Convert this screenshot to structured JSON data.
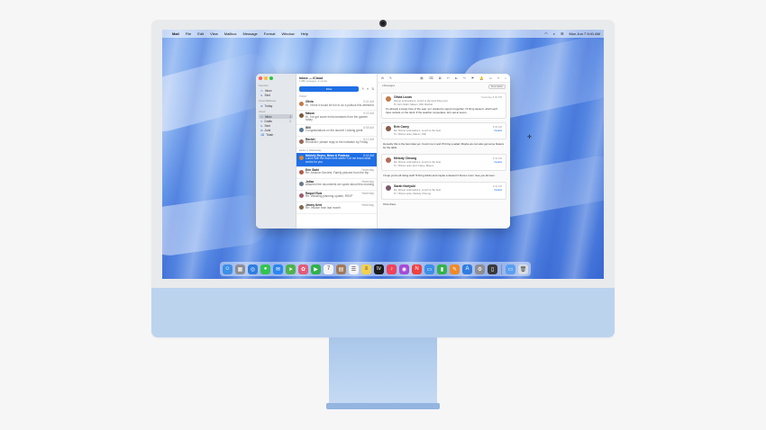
{
  "menubar": {
    "app_name": "Mail",
    "items": [
      "File",
      "Edit",
      "View",
      "Mailbox",
      "Message",
      "Format",
      "Window",
      "Help"
    ],
    "clock": "Mon Jun 7 9:41 AM"
  },
  "mail": {
    "sidebar": {
      "favorites_heading": "Favorites",
      "favorites": [
        {
          "label": "Inbox",
          "icon": "inbox-icon"
        },
        {
          "label": "Sent",
          "icon": "sent-icon"
        }
      ],
      "smart_heading": "Smart Mailboxes",
      "smart": [
        {
          "label": "Today",
          "icon": "gear-icon"
        }
      ],
      "icloud_heading": "iCloud",
      "mailboxes": [
        {
          "label": "Inbox",
          "count": "4",
          "active": true
        },
        {
          "label": "Drafts",
          "count": "2",
          "active": false
        },
        {
          "label": "Sent",
          "count": "",
          "active": false
        },
        {
          "label": "Junk",
          "count": "",
          "active": false
        },
        {
          "label": "Trash",
          "count": "",
          "active": false
        }
      ]
    },
    "list": {
      "title": "Inbox — iCloud",
      "subtitle": "1,988 messages, 4 unread",
      "filter_label": "Filter",
      "today_label": "TODAY",
      "yesterday_label": "Earlier in Wednesday",
      "messages": [
        {
          "from": "Olivia",
          "time": "9:41 AM",
          "preview": "Hi, I think it would be fun to do a potluck this weekend",
          "color": "#c47a4a",
          "selected": false
        },
        {
          "from": "Mason",
          "time": "9:20 AM",
          "preview": "Hi, I've got some extra tomatoes from the garden today",
          "color": "#7a5a3a",
          "selected": false
        },
        {
          "from": "Will",
          "time": "8:55 AM",
          "preview": "Congratulations on the launch! Looking great",
          "color": "#5a7a9a",
          "selected": false
        },
        {
          "from": "Rachel",
          "time": "8:12 AM",
          "preview": "Reminder: please reply to the invitation by Friday",
          "color": "#9a6a5a",
          "selected": false
        },
        {
          "from": "Mckinly Reyes, Brian & Pradeep",
          "time": "8:02 AM",
          "preview": "Lunch with the team next week? Let me know what works for you",
          "color": "#d48a3a",
          "selected": true
        },
        {
          "from": "Erin Stahl",
          "time": "Yesterday",
          "preview": "Re: Amazon Secrets: Family pictures from the trip",
          "color": "#b55a4a",
          "selected": false
        },
        {
          "from": "Jolisa",
          "time": "Yesterday",
          "preview": "Attached the documents we spoke about this morning",
          "color": "#6a7a8a",
          "selected": false
        },
        {
          "from": "Raquel Ruiz",
          "time": "Yesterday",
          "preview": "Re: Wedding planning update, RSVP",
          "color": "#a05a6a",
          "selected": false
        },
        {
          "from": "Jimmy Kent",
          "time": "Yesterday",
          "preview": "Re: Invoice from last month",
          "color": "#7a6a4a",
          "selected": false
        }
      ]
    },
    "reader": {
      "thread_count": "4 Messages",
      "thread_badge": "Summarize",
      "cards": [
        {
          "name": "Olivia Lucas",
          "subject": "Dinner at Emeline's: Lunch is the best thing ever",
          "recipients": "To: Erin Stahl, Mason, Will, Rachel",
          "time": "Yesterday 8:00 PM",
          "reply": "",
          "body": "It's already a lovely time of the year, so I wanted to spend it together. I'll bring dessert, which we'll have outside on the deck. If the weather cooperates, let's eat at seven.",
          "color": "#c47a4a"
        },
        {
          "name": "Erin Carey",
          "subject": "Re: Dinner at Emeline's: Lunch is the best",
          "recipients": "To: Olivia Lucas, Mason, Will",
          "time": "9:30 AM",
          "reply": "Details",
          "body": "",
          "color": "#8a5a4a"
        },
        {
          "name": "Melody Cheung",
          "subject": "Re: Dinner at Emeline's: Lunch is the best",
          "recipients": "To: Olivia Lucas, Erin Carey, Mason",
          "time": "9:33 AM",
          "reply": "Details",
          "body": "",
          "color": "#b36a5a"
        },
        {
          "name": "Sarah Noriyuki",
          "subject": "Re: Dinner at Emeline's: Lunch is the best",
          "recipients": "To: Olivia Lucas, Melody Cheung",
          "time": "9:41 AM",
          "reply": "Details",
          "body": "",
          "color": "#7a5a6a"
        }
      ],
      "between_texts": [
        "Honestly this is the best idea yet. Count me in and I'll bring a salad. Maybe we can also get some flowers for the table.",
        "I hope you're all doing well! I'll bring drinks and maybe a dessert if there's room. See you all soon.",
        "I'll be there."
      ]
    }
  },
  "dock": {
    "apps": [
      {
        "name": "finder-icon",
        "color": "#3d8fe8",
        "glyph": "☺"
      },
      {
        "name": "launchpad-icon",
        "color": "#8e8e93",
        "glyph": "▦"
      },
      {
        "name": "safari-icon",
        "color": "#2f7de0",
        "glyph": "◎"
      },
      {
        "name": "messages-icon",
        "color": "#33c44f",
        "glyph": "●"
      },
      {
        "name": "mail-icon",
        "color": "#2a86f0",
        "glyph": "✉"
      },
      {
        "name": "maps-icon",
        "color": "#4fb34c",
        "glyph": "➤"
      },
      {
        "name": "photos-icon",
        "color": "#e35a7a",
        "glyph": "✿"
      },
      {
        "name": "facetime-icon",
        "color": "#2fb24a",
        "glyph": "▶"
      },
      {
        "name": "calendar-icon",
        "color": "#f4f4f4",
        "glyph": "7"
      },
      {
        "name": "contacts-icon",
        "color": "#a07a5a",
        "glyph": "▤"
      },
      {
        "name": "reminders-icon",
        "color": "#f4f4f4",
        "glyph": "☰"
      },
      {
        "name": "notes-icon",
        "color": "#f5d04a",
        "glyph": "≡"
      },
      {
        "name": "tv-icon",
        "color": "#1c1c1e",
        "glyph": "tv"
      },
      {
        "name": "music-icon",
        "color": "#f0435a",
        "glyph": "♪"
      },
      {
        "name": "podcasts-icon",
        "color": "#a64bd6",
        "glyph": "◉"
      },
      {
        "name": "news-icon",
        "color": "#f04040",
        "glyph": "N"
      },
      {
        "name": "keynote-icon",
        "color": "#3d8fe8",
        "glyph": "▭"
      },
      {
        "name": "numbers-icon",
        "color": "#34b34c",
        "glyph": "▮"
      },
      {
        "name": "pages-icon",
        "color": "#f08a2a",
        "glyph": "✎"
      },
      {
        "name": "appstore-icon",
        "color": "#2f7de0",
        "glyph": "A"
      },
      {
        "name": "settings-icon",
        "color": "#8e8e93",
        "glyph": "⚙"
      },
      {
        "name": "iphone-mirroring-icon",
        "color": "#3a3a3c",
        "glyph": "▯"
      }
    ],
    "extras": [
      {
        "name": "downloads-folder-icon",
        "color": "#5aa0f0",
        "glyph": "▭"
      },
      {
        "name": "trash-icon",
        "color": "#d8dde4",
        "glyph": "🗑"
      }
    ]
  }
}
